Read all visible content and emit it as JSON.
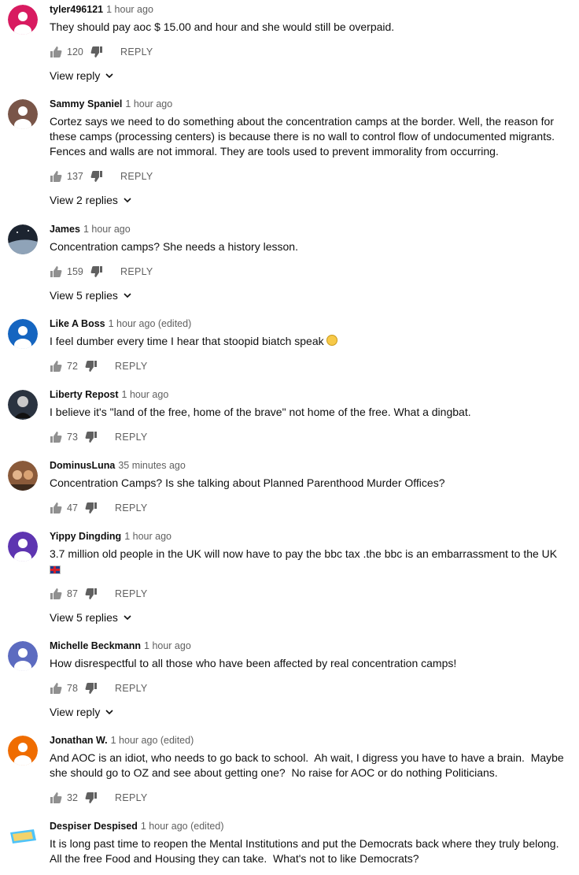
{
  "reply_label": "REPLY",
  "comments": [
    {
      "author": "tyler496121",
      "time": "1 hour ago",
      "text": "They should pay aoc $ 15.00 and hour and she would still be overpaid.",
      "likes": "120",
      "replies": "View reply",
      "avatar_color": "#d81b60"
    },
    {
      "author": "Sammy Spaniel",
      "time": "1 hour ago",
      "text": "Cortez says we need to do something about the concentration camps at the border. Well, the reason for these camps (processing centers) is because there is no wall to control flow of undocumented migrants. Fences and walls are not immoral. They are tools used to prevent immorality from occurring.",
      "likes": "137",
      "replies": "View 2 replies",
      "avatar_color": "#795548"
    },
    {
      "author": "James",
      "time": "1 hour ago",
      "text": "Concentration camps? She needs a history lesson.",
      "likes": "159",
      "replies": "View 5 replies",
      "avatar_color": "#3b4a5a"
    },
    {
      "author": "Like A Boss",
      "time": "1 hour ago (edited)",
      "text": "I feel dumber every time I hear that stoopid biatch speak",
      "likes": "72",
      "replies": "",
      "avatar_color": "#1565c0"
    },
    {
      "author": "Liberty Repost",
      "time": "1 hour ago",
      "text": "I believe it's \"land of the free, home of the brave\" not home of the free. What a dingbat.",
      "likes": "73",
      "replies": "",
      "avatar_color": "#2a3340"
    },
    {
      "author": "DominusLuna",
      "time": "35 minutes ago",
      "text": "Concentration Camps? Is she talking about Planned Parenthood Murder Offices?",
      "likes": "47",
      "replies": "",
      "avatar_color": "#8a5a3a"
    },
    {
      "author": "Yippy Dingding",
      "time": "1 hour ago",
      "text": "3.7 million old people in the UK will now have to pay the bbc tax .the bbc is an embarrassment to the UK",
      "likes": "87",
      "replies": "View 5 replies",
      "avatar_color": "#5e35b1"
    },
    {
      "author": "Michelle Beckmann",
      "time": "1 hour ago",
      "text": "How disrespectful to all those who have been affected by real concentration camps!",
      "likes": "78",
      "replies": "View reply",
      "avatar_color": "#5c6bc0"
    },
    {
      "author": "Jonathan W.",
      "time": "1 hour ago (edited)",
      "text": "And AOC is an idiot, who needs to go back to school.  Ah wait, I digress you have to have a brain.  Maybe she should go to OZ and see about getting one?  No raise for AOC or do nothing Politicians.",
      "likes": "32",
      "replies": "",
      "avatar_color": "#ef6c00"
    },
    {
      "author": "Despiser Despised",
      "time": "1 hour ago (edited)",
      "text": "It is long past time to reopen the Mental Institutions and put the Democrats back where they truly belong.  All the free Food and Housing they can take.  What's not to like Democrats?",
      "likes": "",
      "replies": "",
      "avatar_color": "#4fc3f7"
    }
  ]
}
